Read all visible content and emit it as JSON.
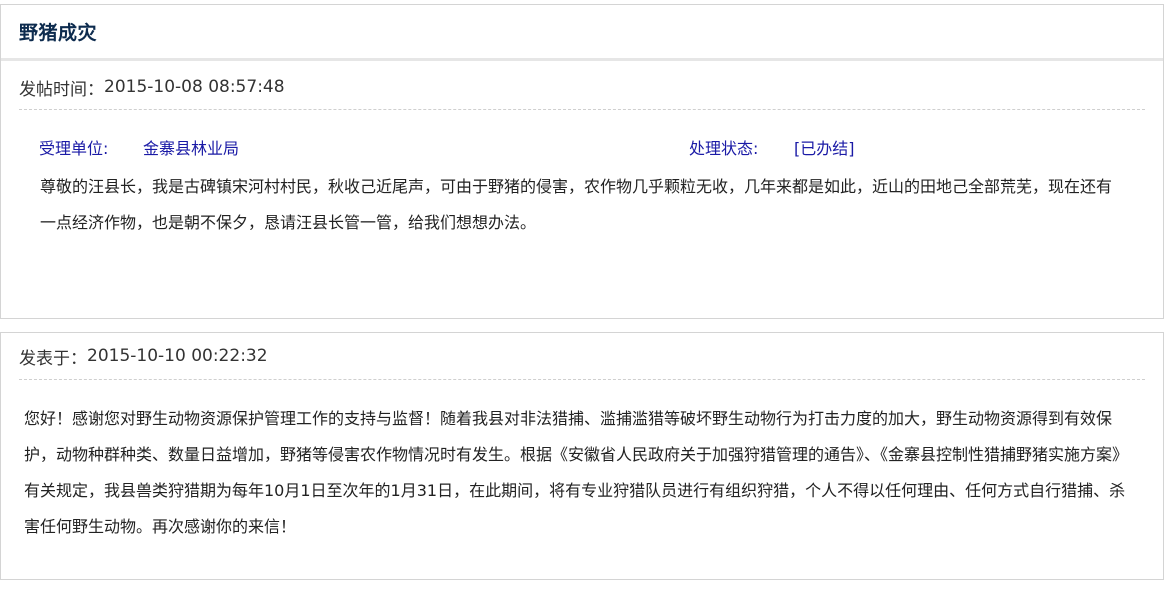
{
  "post": {
    "title": "野猪成灾",
    "time_label": "发帖时间：",
    "time_value": "2015-10-08 08:57:48",
    "unit_label": "受理单位:",
    "unit_value": "金寨县林业局",
    "status_label": "处理状态:",
    "status_value": "[已办结]",
    "content": "尊敬的汪县长，我是古碑镇宋河村村民，秋收己近尾声，可由于野猪的侵害，农作物几乎颗粒无收，几年来都是如此，近山的田地己全部荒芜，现在还有一点经济作物，也是朝不保夕，恳请汪县长管一管，给我们想想办法。"
  },
  "reply": {
    "time_label": "发表于：",
    "time_value": "2015-10-10 00:22:32",
    "content": "您好！感谢您对野生动物资源保护管理工作的支持与监督！随着我县对非法猎捕、滥捕滥猎等破坏野生动物行为打击力度的加大，野生动物资源得到有效保护，动物种群种类、数量日益增加，野猪等侵害农作物情况时有发生。根据《安徽省人民政府关于加强狩猎管理的通告》、《金寨县控制性猎捕野猪实施方案》有关规定，我县兽类狩猎期为每年10月1日至次年的1月31日，在此期间，将有专业狩猎队员进行有组织狩猎，个人不得以任何理由、任何方式自行猎捕、杀害任何野生动物。再次感谢你的来信！"
  }
}
